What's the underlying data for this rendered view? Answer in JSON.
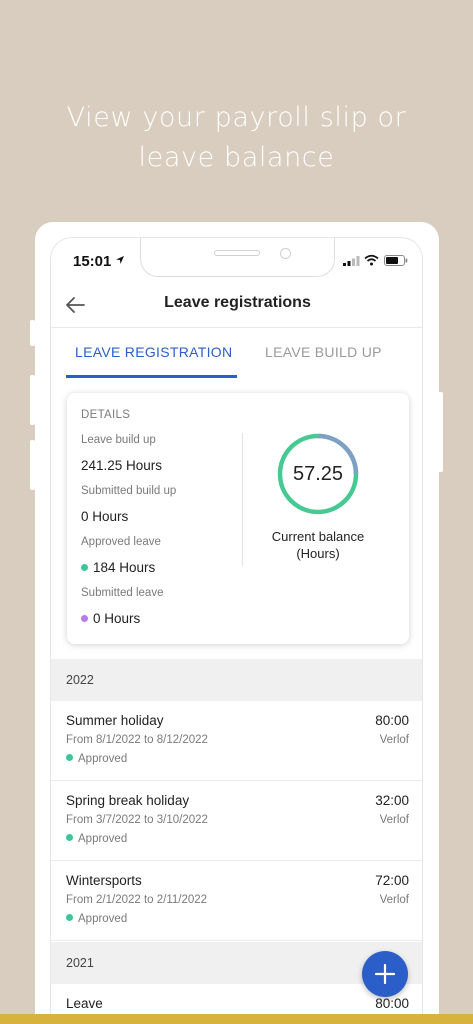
{
  "headline": {
    "line1": "View your payroll slip or",
    "line2": "leave balance"
  },
  "status_bar": {
    "time": "15:01"
  },
  "nav": {
    "title": "Leave registrations"
  },
  "tabs": [
    {
      "label": "LEAVE REGISTRATION",
      "active": true
    },
    {
      "label": "LEAVE BUILD UP",
      "active": false
    }
  ],
  "details": {
    "heading": "DETAILS",
    "leave_build_up_label": "Leave build up",
    "leave_build_up_value": "241.25 Hours",
    "submitted_build_up_label": "Submitted build up",
    "submitted_build_up_value": "0 Hours",
    "approved_leave_label": "Approved leave",
    "approved_leave_value": "184 Hours",
    "submitted_leave_label": "Submitted leave",
    "submitted_leave_value": "0 Hours",
    "balance_value": "57.25",
    "balance_caption_line1": "Current balance",
    "balance_caption_line2": "(Hours)"
  },
  "colors": {
    "accent": "#2b5ec8",
    "approved": "#3cc59a",
    "submitted": "#b57be8",
    "ring_green": "#46c993",
    "ring_blue": "#7fa0c4",
    "background": "#d9cdbf"
  },
  "groups": [
    {
      "year": "2022",
      "entries": [
        {
          "title": "Summer holiday",
          "dates": "From 8/1/2022 to 8/12/2022",
          "status": "Approved",
          "hours": "80:00",
          "type": "Verlof"
        },
        {
          "title": "Spring break holiday",
          "dates": "From 3/7/2022 to 3/10/2022",
          "status": "Approved",
          "hours": "32:00",
          "type": "Verlof"
        },
        {
          "title": "Wintersports",
          "dates": "From 2/1/2022 to 2/11/2022",
          "status": "Approved",
          "hours": "72:00",
          "type": "Verlof"
        }
      ]
    },
    {
      "year": "2021",
      "entries": [
        {
          "title": "Leave",
          "hours": "80:00"
        }
      ]
    }
  ],
  "icons": {
    "back": "arrow-left-icon",
    "add": "plus-icon",
    "location": "location-arrow-icon",
    "signal": "signal-icon",
    "wifi": "wifi-icon",
    "battery": "battery-icon"
  }
}
